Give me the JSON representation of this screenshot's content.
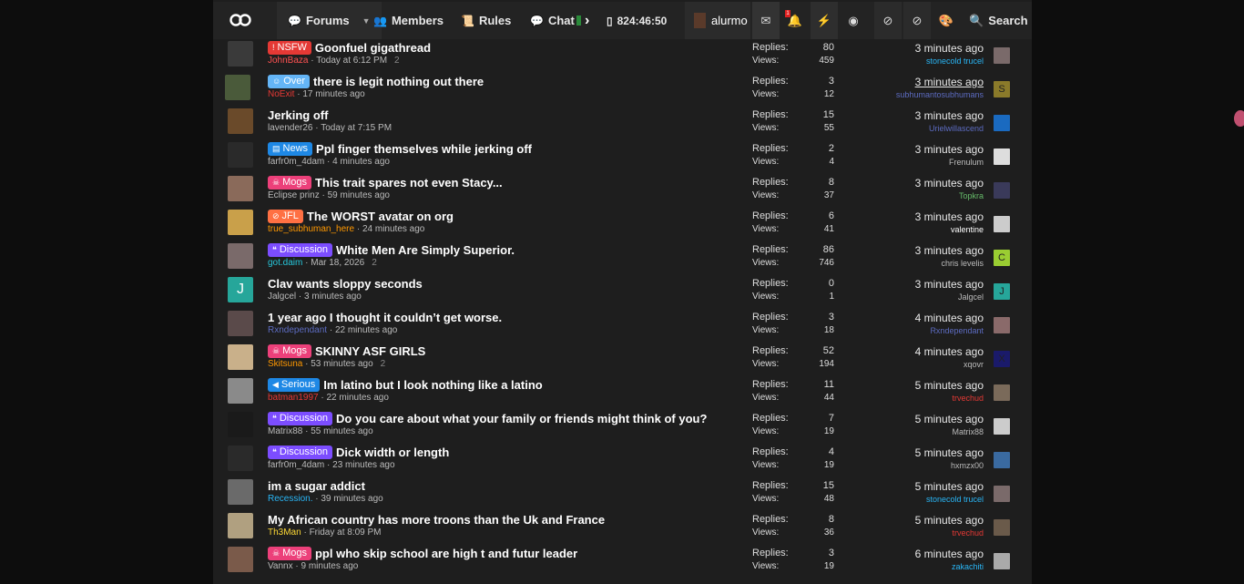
{
  "nav": {
    "forums": "Forums",
    "members": "Members",
    "rules": "Rules",
    "chat": "Chat",
    "timer": "824:46:50",
    "username": "alurmo",
    "search": "Search",
    "bell_count": "1"
  },
  "colors": {
    "page_bg": "#1e1e1e",
    "topbar_bg": "#232323",
    "nsfw": "#e53935",
    "over": "#64b5f6",
    "news": "#1e88e5",
    "mogs": "#ec407a",
    "jfl": "#ff7043",
    "discussion": "#7c4dff",
    "serious": "#1e88e5"
  },
  "threads": [
    {
      "prefix": "NSFW",
      "prefix_icon": "!",
      "title": "Goonfuel gigathread",
      "author": "JohnBaza",
      "author_color": "#ff5252",
      "date": "Today at 6:12 PM",
      "pages": "2",
      "replies": "80",
      "views": "459",
      "last_time": "3 minutes ago",
      "last_user": "stonecold trucel",
      "last_user_color": "#29b6f6"
    },
    {
      "prefix": "Over",
      "prefix_icon": "☺",
      "title": "there is legit nothing out there",
      "author": "NoExit",
      "author_color": "#e53935",
      "date": "17 minutes ago",
      "pages": "",
      "replies": "3",
      "views": "12",
      "last_time": "3 minutes ago",
      "last_user": "subhumantosubhumans",
      "last_user_color": "#5c6bc0"
    },
    {
      "prefix": "",
      "prefix_icon": "",
      "title": "Jerking off",
      "author": "lavender26",
      "author_color": "#bbbbbb",
      "date": "Today at 7:15 PM",
      "pages": "",
      "replies": "15",
      "views": "55",
      "last_time": "3 minutes ago",
      "last_user": "Urielwillascend",
      "last_user_color": "#5c6bc0"
    },
    {
      "prefix": "News",
      "prefix_icon": "▤",
      "title": "Ppl finger themselves while jerking off",
      "author": "farfr0m_4dam",
      "author_color": "#bbbbbb",
      "date": "4 minutes ago",
      "pages": "",
      "replies": "2",
      "views": "4",
      "last_time": "3 minutes ago",
      "last_user": "Frenulum",
      "last_user_color": "#bbbbbb"
    },
    {
      "prefix": "Mogs",
      "prefix_icon": "☠",
      "title": "This trait spares not even Stacy...",
      "author": "Eclipse prinz",
      "author_color": "#bbbbbb",
      "date": "59 minutes ago",
      "pages": "",
      "replies": "8",
      "views": "37",
      "last_time": "3 minutes ago",
      "last_user": "Topkra",
      "last_user_color": "#66bb6a"
    },
    {
      "prefix": "JFL",
      "prefix_icon": "⊘",
      "title": "The WORST avatar on org",
      "author": "true_subhuman_here",
      "author_color": "#ff9800",
      "date": "24 minutes ago",
      "pages": "",
      "replies": "6",
      "views": "41",
      "last_time": "3 minutes ago",
      "last_user": "valentine",
      "last_user_color": "#ffffff"
    },
    {
      "prefix": "Discussion",
      "prefix_icon": "❝",
      "title": "White Men Are Simply Superior.",
      "author": "got.daim",
      "author_color": "#26c6da",
      "date": "Mar 18, 2026",
      "pages": "2",
      "replies": "86",
      "views": "746",
      "last_time": "3 minutes ago",
      "last_user": "chris levelis",
      "last_user_color": "#bbbbbb"
    },
    {
      "prefix": "",
      "prefix_icon": "",
      "title": "Clav wants sloppy seconds",
      "author": "Jalgcel",
      "author_color": "#bbbbbb",
      "date": "3 minutes ago",
      "pages": "",
      "replies": "0",
      "views": "1",
      "last_time": "3 minutes ago",
      "last_user": "Jalgcel",
      "last_user_color": "#bbbbbb"
    },
    {
      "prefix": "",
      "prefix_icon": "",
      "title": "1 year ago I thought it couldn’t get worse.",
      "author": "Rxndependant",
      "author_color": "#5c6bc0",
      "date": "22 minutes ago",
      "pages": "",
      "replies": "3",
      "views": "18",
      "last_time": "4 minutes ago",
      "last_user": "Rxndependant",
      "last_user_color": "#5c6bc0"
    },
    {
      "prefix": "Mogs",
      "prefix_icon": "☠",
      "title": "SKINNY ASF GIRLS",
      "author": "Skitsuna",
      "author_color": "#ff9800",
      "date": "53 minutes ago",
      "pages": "2",
      "replies": "52",
      "views": "194",
      "last_time": "4 minutes ago",
      "last_user": "xqovr",
      "last_user_color": "#bbbbbb"
    },
    {
      "prefix": "Serious",
      "prefix_icon": "◀",
      "title": "Im latino but I look nothing like a latino",
      "author": "batman1997",
      "author_color": "#e53935",
      "date": "22 minutes ago",
      "pages": "",
      "replies": "11",
      "views": "44",
      "last_time": "5 minutes ago",
      "last_user": "trvechud",
      "last_user_color": "#e53935"
    },
    {
      "prefix": "Discussion",
      "prefix_icon": "❝",
      "title": "Do you care about what your family or friends might think of you?",
      "author": "Matrix88",
      "author_color": "#bbbbbb",
      "date": "55 minutes ago",
      "pages": "",
      "replies": "7",
      "views": "19",
      "last_time": "5 minutes ago",
      "last_user": "Matrix88",
      "last_user_color": "#bbbbbb"
    },
    {
      "prefix": "Discussion",
      "prefix_icon": "❝",
      "title": "Dick width or length",
      "author": "farfr0m_4dam",
      "author_color": "#bbbbbb",
      "date": "23 minutes ago",
      "pages": "",
      "replies": "4",
      "views": "19",
      "last_time": "5 minutes ago",
      "last_user": "hxmzx00",
      "last_user_color": "#bbbbbb"
    },
    {
      "prefix": "",
      "prefix_icon": "",
      "title": "im a sugar addict",
      "author": "Recession.",
      "author_color": "#29b6f6",
      "date": "39 minutes ago",
      "pages": "",
      "replies": "15",
      "views": "48",
      "last_time": "5 minutes ago",
      "last_user": "stonecold trucel",
      "last_user_color": "#29b6f6"
    },
    {
      "prefix": "",
      "prefix_icon": "",
      "title": "My African country has more troons than the Uk and France",
      "author": "Th3Man",
      "author_color": "#fdd835",
      "date": "Friday at 8:09 PM",
      "pages": "",
      "replies": "8",
      "views": "36",
      "last_time": "5 minutes ago",
      "last_user": "trvechud",
      "last_user_color": "#e53935"
    },
    {
      "prefix": "Mogs",
      "prefix_icon": "☠",
      "title": "ppl who skip school are high t and futur leader",
      "author": "Vannx",
      "author_color": "#bbbbbb",
      "date": "9 minutes ago",
      "pages": "",
      "replies": "3",
      "views": "19",
      "last_time": "6 minutes ago",
      "last_user": "zakachiti",
      "last_user_color": "#29b6f6"
    }
  ],
  "labels": {
    "replies": "Replies:",
    "views": "Views:"
  }
}
